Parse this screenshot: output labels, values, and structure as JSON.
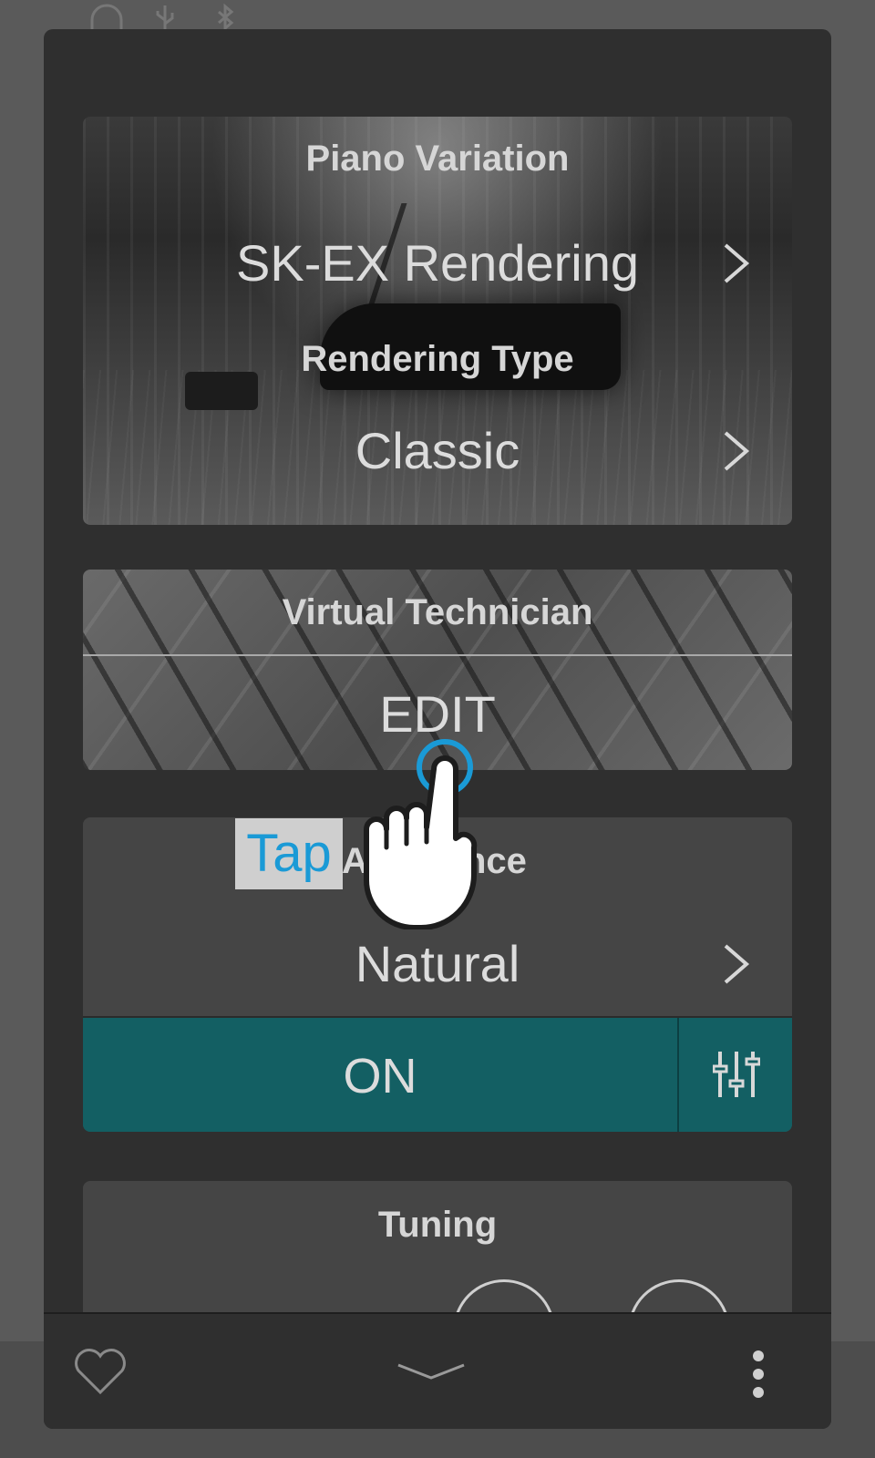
{
  "status_bar": {
    "icons": [
      "headphones-icon",
      "usb-icon",
      "bluetooth-icon"
    ]
  },
  "piano_variation": {
    "title": "Piano Variation",
    "value": "SK-EX Rendering"
  },
  "rendering_type": {
    "title": "Rendering Type",
    "value": "Classic"
  },
  "virtual_technician": {
    "title": "Virtual Technician",
    "action": "EDIT"
  },
  "touch": {
    "title_visible": "A",
    "title_visible_end": "nce",
    "value": "Natural",
    "toggle": "ON"
  },
  "tuning": {
    "title": "Tuning"
  },
  "overlay": {
    "tap_label": "Tap"
  },
  "footer": {
    "icons": [
      "heart-icon",
      "chevron-down-icon",
      "more-vertical-icon"
    ]
  },
  "colors": {
    "accent_teal": "#135f63",
    "tap_blue": "#1a9ad6"
  }
}
